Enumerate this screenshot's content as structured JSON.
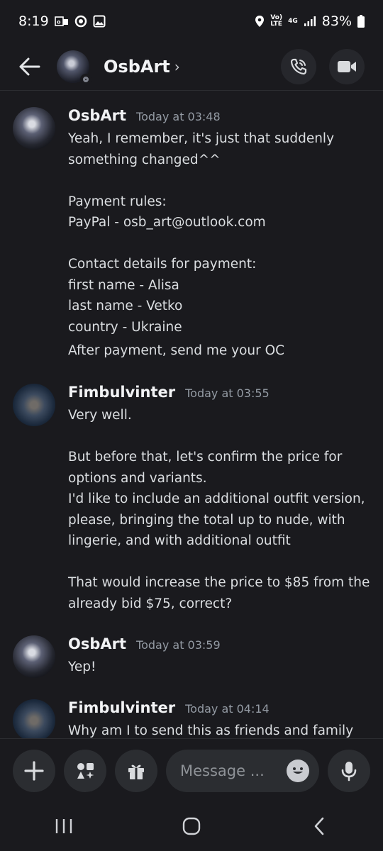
{
  "status_bar": {
    "time": "8:19",
    "battery": "83%",
    "network": "4G",
    "left_icons": [
      "outlook-icon",
      "circle-app-icon",
      "gallery-icon"
    ],
    "right_icons": [
      "location-icon",
      "volte-icon",
      "signal-icon",
      "battery-icon"
    ]
  },
  "header": {
    "title": "OsbArt",
    "chevron": "›",
    "actions": [
      "call-icon",
      "video-icon"
    ]
  },
  "messages": [
    {
      "author": "OsbArt",
      "time": "Today at 03:48",
      "lines": [
        "Yeah, I remember, it's just that suddenly",
        "something changed^^",
        "",
        "Payment rules:",
        "PayPal - osb_art@outlook.com",
        "",
        "Contact details for payment:",
        "first name - Alisa",
        "last name - Vetko",
        "country - Ukraine"
      ],
      "extra_line": "After payment, send me your OC"
    },
    {
      "author": "Fimbulvinter",
      "time": "Today at 03:55",
      "lines": [
        "Very well.",
        "",
        "But before that, let's confirm the price for",
        "options and variants.",
        "I'd like to include an additional outfit version,",
        "please, bringing the total up to nude, with",
        "lingerie, and with additional outfit",
        "",
        "That would increase the price to $85 from the",
        "already bid  $75, correct?"
      ]
    },
    {
      "author": "OsbArt",
      "time": "Today at 03:59",
      "lines": [
        "Yep!"
      ]
    },
    {
      "author": "Fimbulvinter",
      "time": "Today at 04:14",
      "lines": [
        "Why am I to send this as friends and family"
      ]
    }
  ],
  "composer": {
    "placeholder": "Message ...",
    "buttons": [
      "plus-icon",
      "apps-icon",
      "gift-icon"
    ],
    "right_buttons": [
      "emoji-icon",
      "microphone-icon"
    ]
  },
  "nav": [
    "recents-icon",
    "home-icon",
    "back-icon"
  ],
  "colors": {
    "background": "#1a1a1e",
    "button_bg": "#2b2d31",
    "text": "#dbdee1",
    "muted": "#949ba4"
  }
}
